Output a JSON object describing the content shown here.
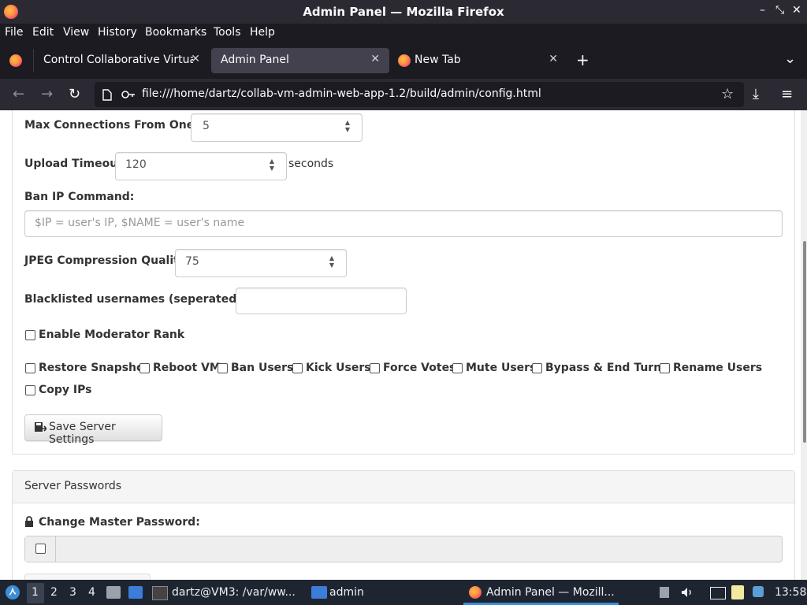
{
  "window": {
    "title": "Admin Panel — Mozilla Firefox",
    "controls": [
      "–",
      "⤡",
      "✕"
    ]
  },
  "menubar": {
    "items": [
      "File",
      "Edit",
      "View",
      "History",
      "Bookmarks",
      "Tools",
      "Help"
    ]
  },
  "tabs": [
    {
      "label": "Control Collaborative Virtual",
      "close": "✕"
    },
    {
      "label": "Admin Panel",
      "close": "✕"
    },
    {
      "label": "New Tab",
      "close": "✕"
    }
  ],
  "tabbar": {
    "new_tab": "+",
    "list_all": "⌄"
  },
  "nav": {
    "back": "←",
    "forward": "→",
    "reload": "↻",
    "url": "file:///home/dartz/collab-vm-admin-web-app-1.2/build/admin/config.html",
    "bookmark": "☆",
    "downloads": "⤓",
    "menu": "≡"
  },
  "form": {
    "max_connections": {
      "label": "Max Connections From One IP:",
      "value": "5"
    },
    "upload_timeout": {
      "label": "Upload Timeout:",
      "value": "120",
      "suffix": "seconds"
    },
    "ban_ip": {
      "label": "Ban IP Command:",
      "placeholder": "$IP = user's IP, $NAME = user's name"
    },
    "jpeg_quality": {
      "label": "JPEG Compression Quality:",
      "value": "75"
    },
    "blacklist": {
      "label": "Blacklisted usernames (seperated by ;):",
      "value": ""
    },
    "enable_mod": {
      "label": "Enable Moderator Rank",
      "checked": false
    },
    "permissions": [
      {
        "label": "Restore Snapshot",
        "checked": false
      },
      {
        "label": "Reboot VM",
        "checked": false
      },
      {
        "label": "Ban Users",
        "checked": false
      },
      {
        "label": "Kick Users",
        "checked": false
      },
      {
        "label": "Force Votes",
        "checked": false
      },
      {
        "label": "Mute Users",
        "checked": false
      },
      {
        "label": "Bypass & End Turns",
        "checked": false
      },
      {
        "label": "Rename Users",
        "checked": false
      },
      {
        "label": "Copy IPs",
        "checked": false
      }
    ],
    "save_button": "Save Server Settings"
  },
  "passwords_panel": {
    "heading": "Server Passwords",
    "master_label": "Change Master Password:",
    "master_value": ""
  },
  "taskbar": {
    "workspaces": [
      "1",
      "2",
      "3",
      "4"
    ],
    "terminal": "dartz@VM3: /var/ww...",
    "folder": "admin",
    "firefox": "Admin Panel — Mozill...",
    "clock": "13:58"
  },
  "colors": {
    "titlebar": "#2b2a33",
    "toolbar": "#1c1b22",
    "active_tab": "#42414d",
    "taskbar": "#1f2530"
  }
}
